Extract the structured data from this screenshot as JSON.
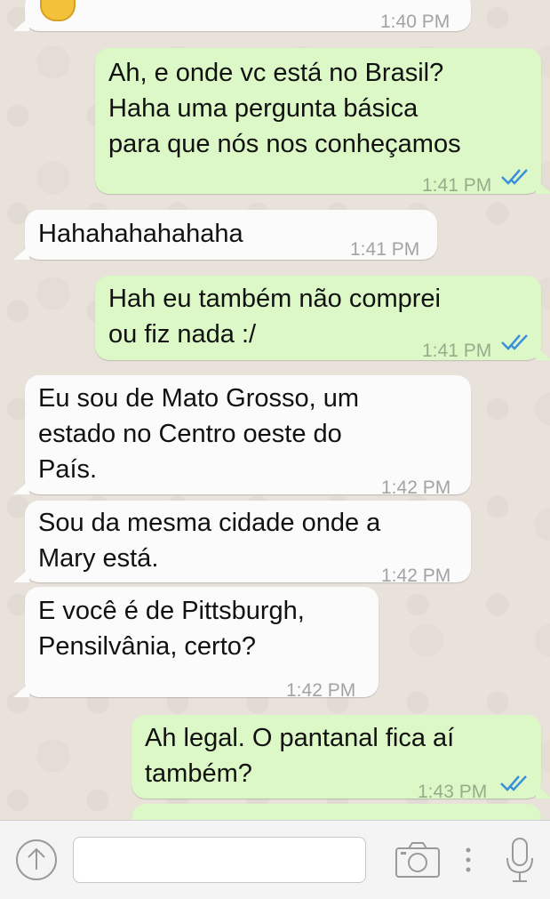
{
  "messages": [
    {
      "dir": "in",
      "lines": [],
      "time": "1:40 PM",
      "emoji": "unamused-face"
    },
    {
      "dir": "out",
      "lines": [
        "Ah, e onde vc está no Brasil?",
        "Haha uma pergunta básica",
        "para que nós nos conheçamos"
      ],
      "time": "1:41 PM",
      "status": "read-ticks"
    },
    {
      "dir": "in",
      "lines": [
        "Hahahahahahaha"
      ],
      "time": "1:41 PM"
    },
    {
      "dir": "out",
      "lines": [
        "Hah eu também não comprei",
        "ou fiz nada :/"
      ],
      "time": "1:41 PM",
      "status": "read-ticks"
    },
    {
      "dir": "in",
      "lines": [
        "Eu sou de Mato Grosso, um",
        "estado no Centro oeste do",
        "País."
      ],
      "time": "1:42 PM"
    },
    {
      "dir": "in",
      "lines": [
        "Sou da mesma cidade onde a",
        "Mary está."
      ],
      "time": "1:42 PM"
    },
    {
      "dir": "in",
      "lines": [
        "E você é de Pittsburgh,",
        "Pensilvânia, certo?"
      ],
      "time": "1:42 PM"
    },
    {
      "dir": "out",
      "lines": [
        "Ah legal. O pantanal fica aí",
        "também?"
      ],
      "time": "1:43 PM",
      "status": "read-ticks"
    }
  ],
  "input": {
    "placeholder": "",
    "value": ""
  },
  "icons": {
    "share": "share-up-arrow-icon",
    "camera": "camera-icon",
    "more": "more-dots-icon",
    "mic": "microphone-icon",
    "ticks": "double-check-icon"
  },
  "colors": {
    "outgoing_bubble": "#dcf8c6",
    "incoming_bubble": "#fbfbfb",
    "read_ticks": "#3c8fdc",
    "wallpaper": "#e8e2da"
  }
}
